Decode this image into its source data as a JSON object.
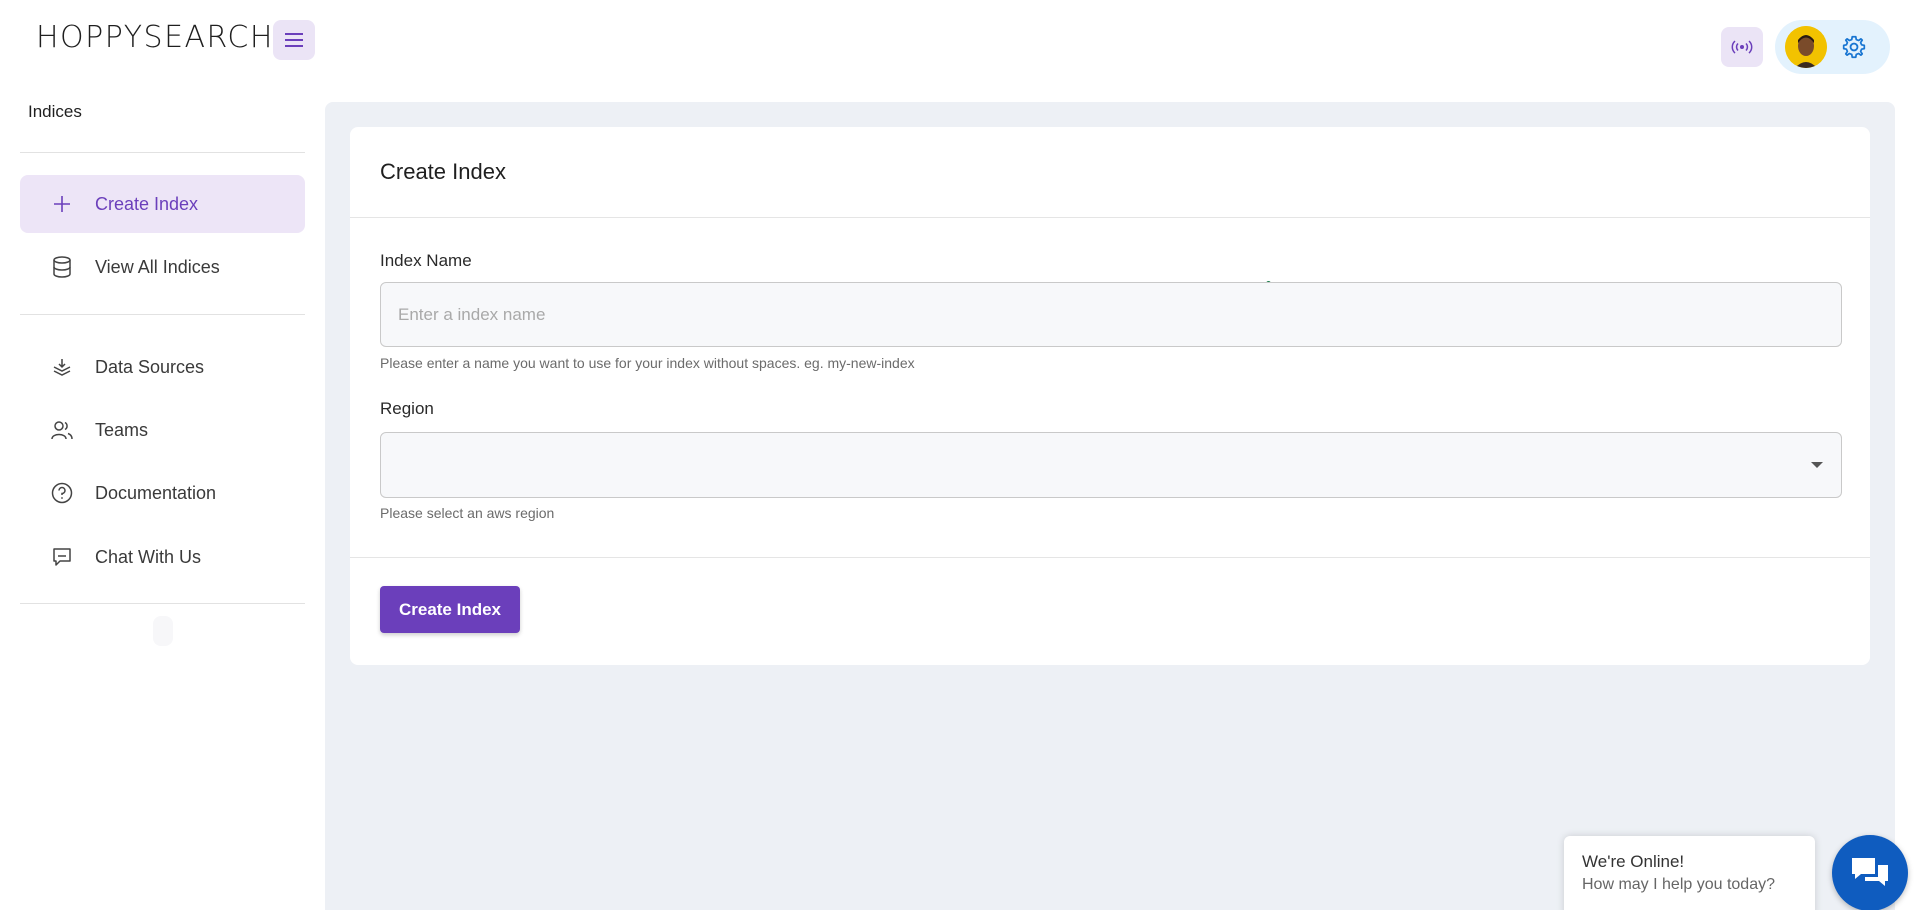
{
  "header": {
    "logo": "HOPPYSEARCH",
    "menu_icon": "hamburger-icon",
    "broadcast_icon": "broadcast-icon",
    "settings_icon": "gear-icon"
  },
  "sidebar": {
    "title": "Indices",
    "items": [
      {
        "label": "Create Index",
        "icon": "plus-icon",
        "active": true
      },
      {
        "label": "View All Indices",
        "icon": "database-icon",
        "active": false
      },
      {
        "label": "Data Sources",
        "icon": "layers-icon",
        "active": false
      },
      {
        "label": "Teams",
        "icon": "users-icon",
        "active": false
      },
      {
        "label": "Documentation",
        "icon": "help-circle-icon",
        "active": false
      },
      {
        "label": "Chat With Us",
        "icon": "chat-icon",
        "active": false
      }
    ]
  },
  "form": {
    "title": "Create Index",
    "index_name_label": "Index Name",
    "index_name_value": "",
    "index_name_placeholder": "Enter a index name",
    "index_name_help": "Please enter a name you want to use for your index without spaces. eg. my-new-index",
    "region_label": "Region",
    "region_value": "",
    "region_help": "Please select an aws region",
    "submit_label": "Create Index"
  },
  "chat_widget": {
    "title": "We're Online!",
    "subtitle": "How may I help you today?"
  },
  "colors": {
    "accent": "#6b3fbb",
    "accent_light": "#ede5f7",
    "main_bg": "#edf0f5",
    "chat_blue": "#0f5cbf"
  }
}
